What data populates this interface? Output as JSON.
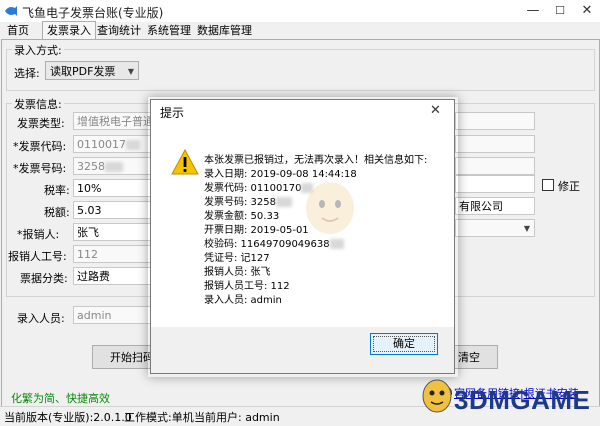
{
  "window": {
    "title": "飞鱼电子发票台账(专业版)",
    "buttons": {
      "minimize": "—",
      "maximize": "☐",
      "close": "✕"
    }
  },
  "tabs": [
    "首页",
    "发票录入",
    "查询统计",
    "系统管理",
    "数据库管理"
  ],
  "entry_mode": {
    "group_label": "录入方式:",
    "select_label": "选择:",
    "select_value": "读取PDF发票"
  },
  "invoice": {
    "group_label": "发票信息:",
    "type_label": "发票类型:",
    "type_value": "增值税电子普通",
    "code_label": "*发票代码:",
    "code_value": "0110017",
    "number_label": "*发票号码:",
    "number_value": "3258",
    "tax_rate_label": "税率:",
    "tax_rate_value": "10%",
    "tax_amount_label": "税额:",
    "tax_amount_value": "5.03",
    "reimburser_label": "*报销人:",
    "reimburser_value": "张飞",
    "reimburser_id_label": "报销人工号:",
    "reimburser_id_value": "112",
    "category_label": "票据分类:",
    "category_value": "过路费",
    "right_partial": "有限公司",
    "modify_label": "修正"
  },
  "entry_person": {
    "label": "录入人员:",
    "value": "admin"
  },
  "actions": {
    "start_scan": "开始扫码",
    "clear": "清空"
  },
  "slogan": "化繁为简、快捷高效",
  "links": {
    "backup": "官网备用链接|根证书安装"
  },
  "status": {
    "version": "当前版本(专业版):2.0.1.0",
    "mode": "工作模式:单机",
    "user": "当前用户: admin"
  },
  "dialog": {
    "title": "提示",
    "close": "✕",
    "message": "本张发票已报销过，无法再次录入！相关信息如下:",
    "lines": [
      "录入日期: 2019-09-08 14:44:18",
      "发票代码: 01100170",
      "发票号码: 3258",
      "发票金额: 50.33",
      "开票日期: 2019-05-01",
      "校验码: 11649709049638",
      "凭证号: 记127",
      "报销人员: 张飞",
      "报销人员工号: 112",
      "录入人员: admin"
    ],
    "ok_label": "确定"
  },
  "watermark": {
    "text": "3DMGAME"
  },
  "colors": {
    "accent": "#0078d7",
    "warning": "#f5c400",
    "watermark": "#1d3a8a",
    "link": "#0000cc",
    "slogan": "#0a8a0a"
  }
}
